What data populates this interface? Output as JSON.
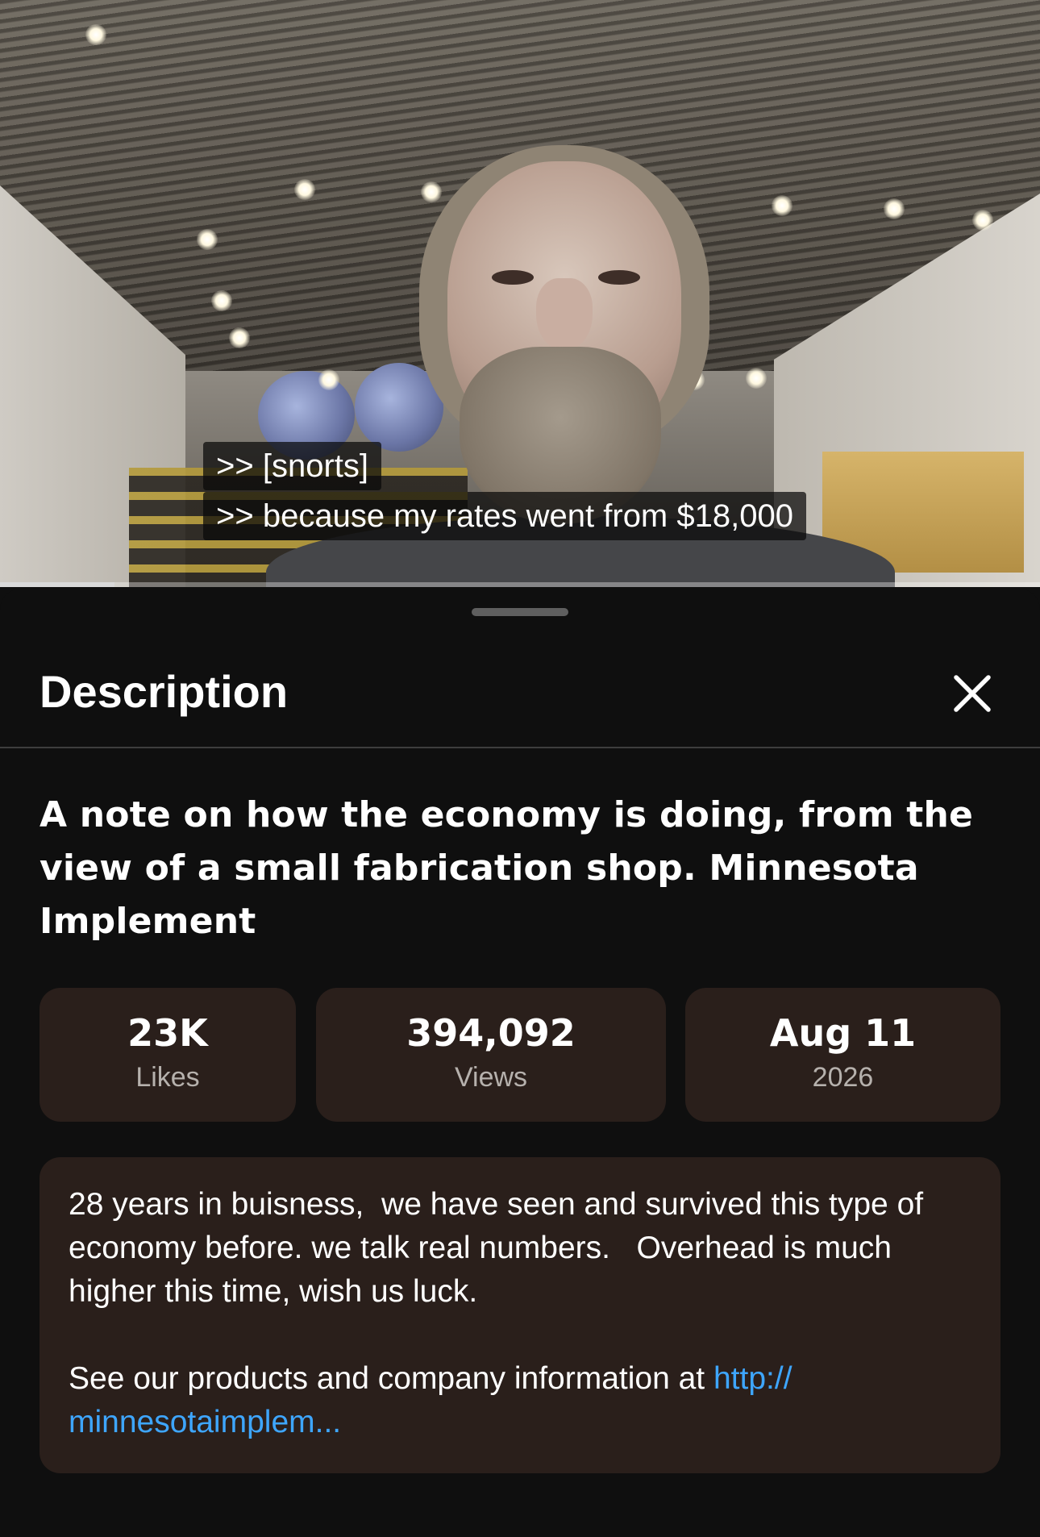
{
  "video": {
    "captions": [
      ">> [snorts]",
      ">> because my rates went from $18,000"
    ],
    "progress_fraction": 0.11
  },
  "sheet": {
    "title": "Description",
    "close_icon": "close-icon"
  },
  "video_title": "A note on how the economy is doing, from the view of a small fabrication shop. Minnesota Implement",
  "stats": [
    {
      "value": "23K",
      "label": "Likes"
    },
    {
      "value": "394,092",
      "label": "Views"
    },
    {
      "value": "Aug 11",
      "label": "2026"
    }
  ],
  "description": {
    "text": "28 years in buisness,  we have seen and survived this type of economy before. we talk real numbers.   Overhead is much higher this time, wish us luck.",
    "link_prefix": "See our products and company information at ",
    "link_text": "http:// minnesotaimplem..."
  },
  "colors": {
    "background": "#0f0f0f",
    "card": "#2a1f1b",
    "link": "#3ea6ff",
    "muted_label": "#b6b1ad"
  }
}
